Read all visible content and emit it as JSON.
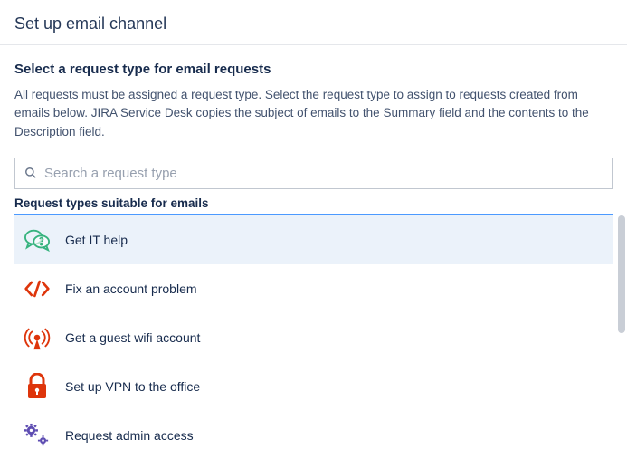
{
  "header": {
    "title": "Set up email channel"
  },
  "section": {
    "subheading": "Select a request type for email requests",
    "description": "All requests must be assigned a request type. Select the request type to assign to requests created from emails below. JIRA Service Desk copies the subject of emails to the Summary field and the contents to the Description field."
  },
  "search": {
    "placeholder": "Search a request type",
    "value": ""
  },
  "group_label": "Request types suitable for emails",
  "items": [
    {
      "label": "Get IT help",
      "icon": "speech-question",
      "color": "#36B37E",
      "selected": true
    },
    {
      "label": "Fix an account problem",
      "icon": "code",
      "color": "#DE350B",
      "selected": false
    },
    {
      "label": "Get a guest wifi account",
      "icon": "wifi-antenna",
      "color": "#DE350B",
      "selected": false
    },
    {
      "label": "Set up VPN to the office",
      "icon": "lock",
      "color": "#DE350B",
      "selected": false
    },
    {
      "label": "Request admin access",
      "icon": "gears",
      "color": "#5E4DB2",
      "selected": false
    }
  ]
}
